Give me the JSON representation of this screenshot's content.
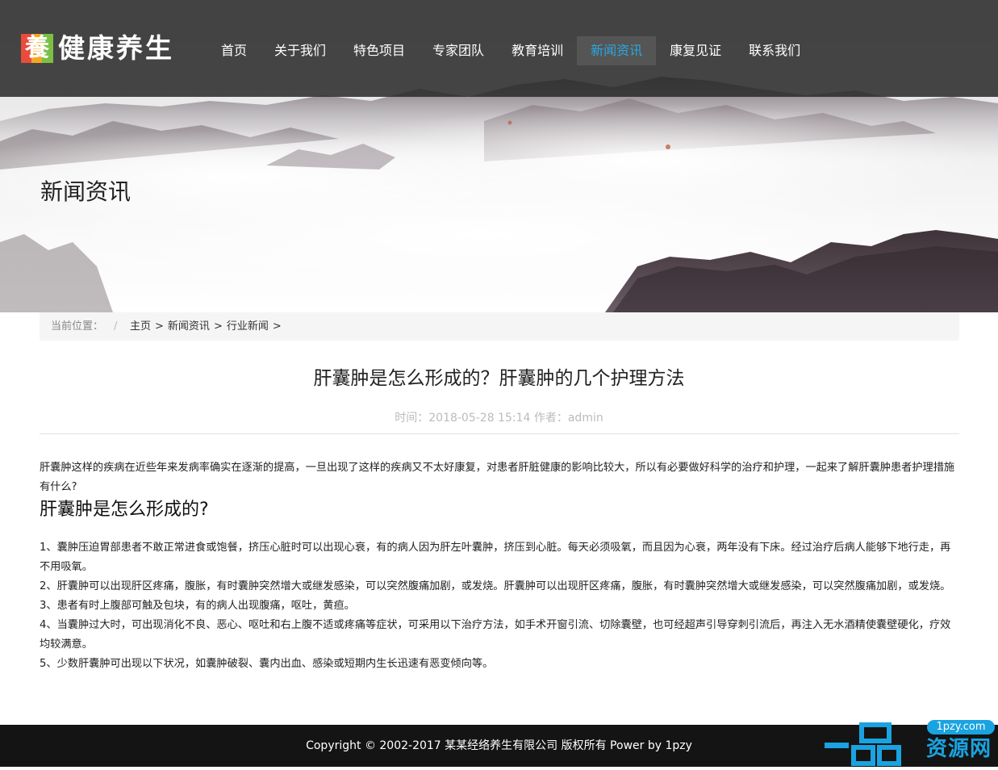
{
  "header": {
    "logo_text": "健康养生",
    "logo_badge_char": "養",
    "nav": [
      {
        "label": "首页",
        "active": false
      },
      {
        "label": "关于我们",
        "active": false
      },
      {
        "label": "特色项目",
        "active": false
      },
      {
        "label": "专家团队",
        "active": false
      },
      {
        "label": "教育培训",
        "active": false
      },
      {
        "label": "新闻资讯",
        "active": true
      },
      {
        "label": "康复见证",
        "active": false
      },
      {
        "label": "联系我们",
        "active": false
      }
    ]
  },
  "banner": {
    "title": "新闻资讯"
  },
  "breadcrumb": {
    "label": "当前位置：",
    "separator": "/",
    "items": [
      "主页",
      "新闻资讯",
      "行业新闻"
    ],
    "arrow": ">"
  },
  "article": {
    "title": "肝囊肿是怎么形成的？肝囊肿的几个护理方法",
    "meta": "时间：2018-05-28 15:14 作者：admin",
    "intro": "肝囊肿这样的疾病在近些年来发病率确实在逐渐的提高，一旦出现了这样的疾病又不太好康复，对患者肝脏健康的影响比较大，所以有必要做好科学的治疗和护理，一起来了解肝囊肿患者护理措施有什么?",
    "subheading": "肝囊肿是怎么形成的?",
    "points": [
      "1、囊肿压迫胃部患者不敢正常进食或饱餐，挤压心脏时可以出现心衰，有的病人因为肝左叶囊肿，挤压到心脏。每天必须吸氧，而且因为心衰，两年没有下床。经过治疗后病人能够下地行走，再不用吸氧。",
      "2、肝囊肿可以出现肝区疼痛，腹胀，有时囊肿突然增大或继发感染，可以突然腹痛加剧，或发烧。肝囊肿可以出现肝区疼痛，腹胀，有时囊肿突然增大或继发感染，可以突然腹痛加剧，或发烧。",
      "3、患者有时上腹部可触及包块，有的病人出现腹痛，呕吐，黄疸。",
      "4、当囊肿过大时，可出现消化不良、恶心、呕吐和右上腹不适或疼痛等症状，可采用以下治疗方法，如手术开窗引流、切除囊壁，也可经超声引导穿刺引流后，再注入无水酒精使囊壁硬化，疗效均较满意。",
      "5、少数肝囊肿可出现以下状况，如囊肿破裂、囊内出血、感染或短期内生长迅速有恶变倾向等。"
    ]
  },
  "footer": {
    "copyright": "Copyright © 2002-2017 某某经络养生有限公司 版权所有 Power by 1pzy"
  },
  "watermark": {
    "domain": "1pzy.com",
    "name": "资源网",
    "glyph": "一品"
  },
  "colors": {
    "topbar": "#2e2e2e",
    "nav_active_text": "#2aa7e0",
    "footer": "#141414",
    "watermark": "#1aa3e0"
  }
}
